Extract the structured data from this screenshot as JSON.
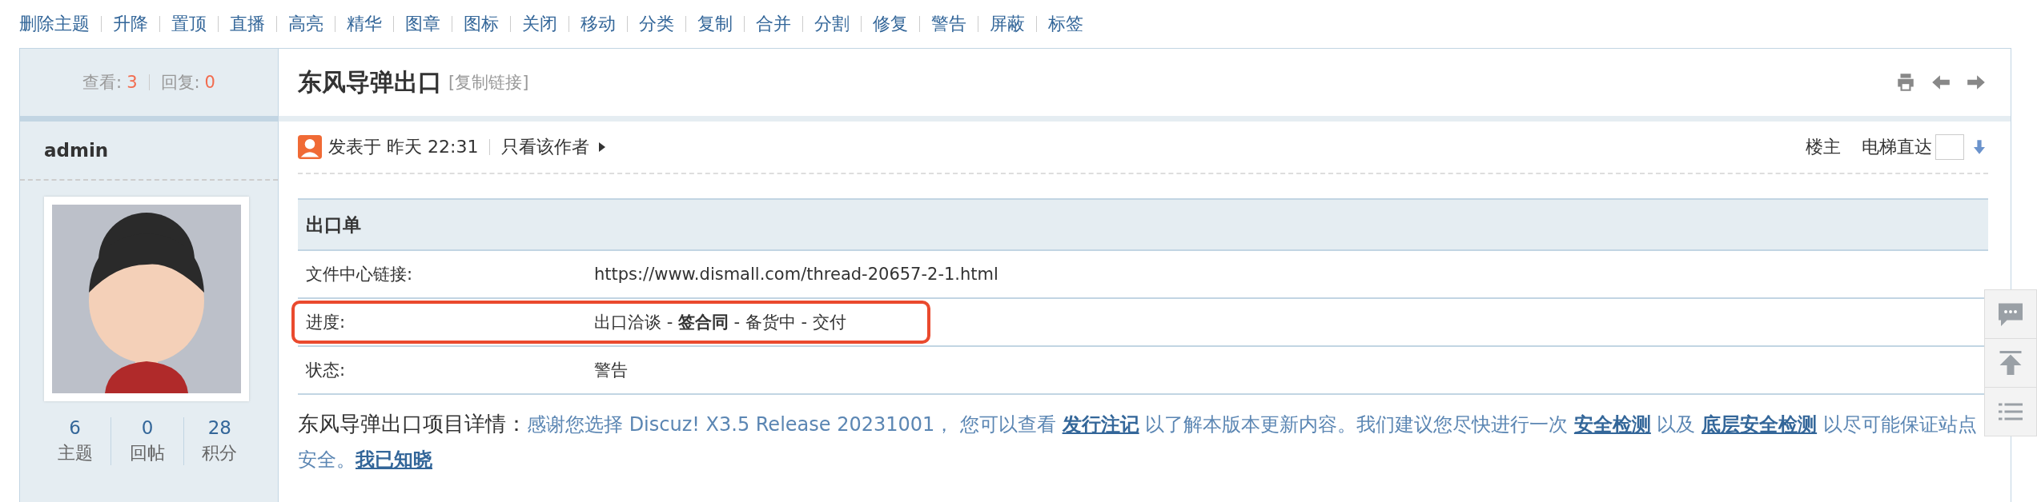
{
  "toolbar": {
    "actions": [
      "删除主题",
      "升降",
      "置顶",
      "直播",
      "高亮",
      "精华",
      "图章",
      "图标",
      "关闭",
      "移动",
      "分类",
      "复制",
      "合并",
      "分割",
      "修复",
      "警告",
      "屏蔽",
      "标签"
    ]
  },
  "thread_stats": {
    "views_label": "查看:",
    "views": "3",
    "replies_label": "回复:",
    "replies": "0"
  },
  "thread": {
    "title": "东风导弹出口",
    "copy_link": "[复制链接]"
  },
  "author": {
    "name": "admin",
    "stats": [
      {
        "value": "6",
        "label": "主题"
      },
      {
        "value": "0",
        "label": "回帖"
      },
      {
        "value": "28",
        "label": "积分"
      }
    ]
  },
  "post": {
    "posted": "发表于 昨天 22:31",
    "author_only": "只看该作者",
    "floor": "楼主",
    "elevator": "电梯直达"
  },
  "form": {
    "title": "出口单",
    "rows": [
      {
        "label": "文件中心链接:",
        "value": "https://www.dismall.com/thread-20657-2-1.html",
        "highlighted": false
      },
      {
        "label": "进度:",
        "value": "出口洽谈 - **签合同** - 备货中 - 交付",
        "highlighted": true
      },
      {
        "label": "状态:",
        "value": "警告",
        "highlighted": false
      }
    ]
  },
  "details": {
    "label": "东风导弹出口项目详情：",
    "parts": [
      {
        "kind": "text",
        "text": "感谢您选择 Discuz! X3.5 Release 20231001， 您可以查看 "
      },
      {
        "kind": "link",
        "text": "发行注记"
      },
      {
        "kind": "text",
        "text": " 以了解本版本更新内容。我们建议您尽快进行一次 "
      },
      {
        "kind": "link",
        "text": "安全检测"
      },
      {
        "kind": "text",
        "text": " 以及 "
      },
      {
        "kind": "link",
        "text": "底层安全检测"
      },
      {
        "kind": "text",
        "text": " 以尽可能保证站点安全。"
      },
      {
        "kind": "link",
        "text": "我已知晓"
      }
    ]
  }
}
